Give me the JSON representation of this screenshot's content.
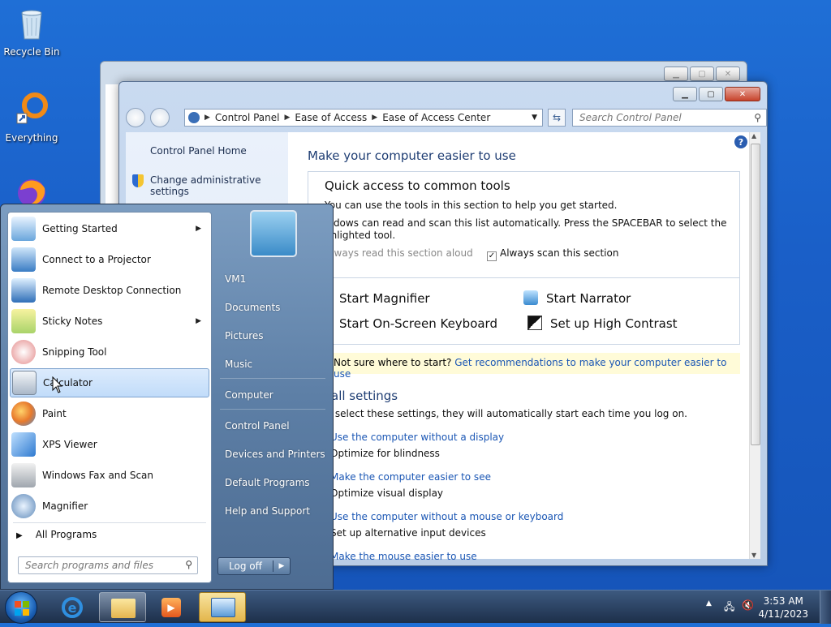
{
  "desktop": {
    "icons": [
      {
        "label": "Recycle Bin",
        "icon": "recycle-bin-icon"
      },
      {
        "label": "Everything",
        "icon": "everything-search-icon"
      },
      {
        "label": "",
        "icon": "firefox-icon"
      }
    ]
  },
  "window": {
    "breadcrumb": [
      "Control Panel",
      "Ease of Access",
      "Ease of Access Center"
    ],
    "search_placeholder": "Search Control Panel",
    "sidebar": {
      "home": "Control Panel Home",
      "admin": "Change administrative settings"
    },
    "heading": "Make your computer easier to use",
    "quick": {
      "title": "Quick access to common tools",
      "line1": "You can use the tools in this section to help you get started.",
      "line2": "indows can read and scan this list automatically.  Press the SPACEBAR to select the",
      "line3": "ghlighted tool.",
      "read_aloud": "Always read this section aloud",
      "scan": "Always scan this section",
      "tools": [
        "Start Magnifier",
        "Start Narrator",
        "Start On-Screen Keyboard",
        "Set up High Contrast"
      ]
    },
    "tip": {
      "prefix": "Not sure where to start?",
      "link": "Get recommendations to make your computer easier to use"
    },
    "explore": {
      "title": "ore all settings",
      "sub": "you select these settings, they will automatically start each time you log on.",
      "items": [
        {
          "link": "Use the computer without a display",
          "desc": "Optimize for blindness"
        },
        {
          "link": "Make the computer easier to see",
          "desc": "Optimize visual display"
        },
        {
          "link": "Use the computer without a mouse or keyboard",
          "desc": "Set up alternative input devices"
        },
        {
          "link": "Make the mouse easier to use",
          "desc": ""
        }
      ]
    }
  },
  "start_menu": {
    "programs": [
      {
        "label": "Getting Started",
        "submenu": true
      },
      {
        "label": "Connect to a Projector",
        "submenu": false
      },
      {
        "label": "Remote Desktop Connection",
        "submenu": false
      },
      {
        "label": "Sticky Notes",
        "submenu": true
      },
      {
        "label": "Snipping Tool",
        "submenu": false
      },
      {
        "label": "Calculator",
        "submenu": false
      },
      {
        "label": "Paint",
        "submenu": false
      },
      {
        "label": "XPS Viewer",
        "submenu": false
      },
      {
        "label": "Windows Fax and Scan",
        "submenu": false
      },
      {
        "label": "Magnifier",
        "submenu": false
      }
    ],
    "all_programs": "All Programs",
    "search_placeholder": "Search programs and files",
    "right": [
      "VM1",
      "Documents",
      "Pictures",
      "Music",
      "Computer",
      "Control Panel",
      "Devices and Printers",
      "Default Programs",
      "Help and Support"
    ],
    "logoff": "Log off"
  },
  "taskbar": {
    "time": "3:53 AM",
    "date": "4/11/2023"
  }
}
